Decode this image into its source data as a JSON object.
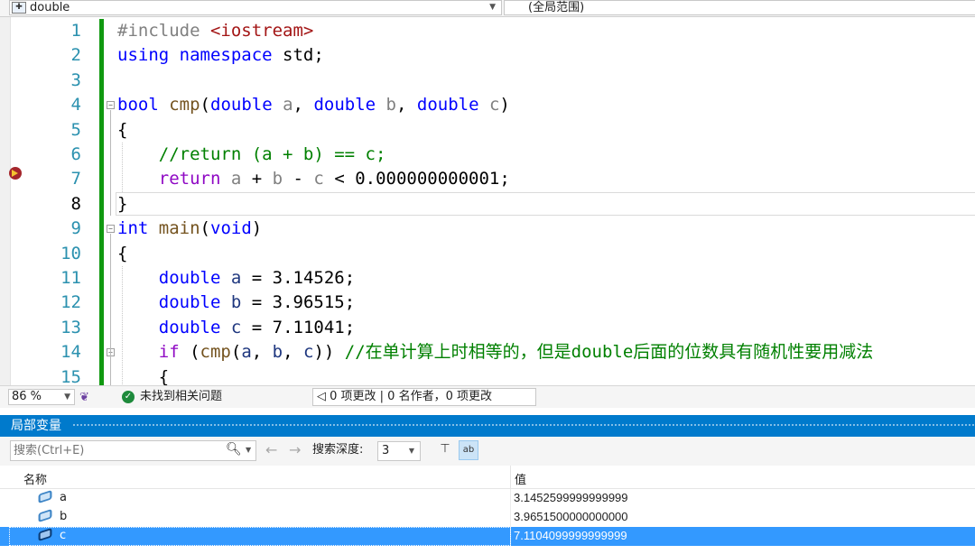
{
  "nav": {
    "class_combo": "double",
    "scope_combo": "(全局范围)"
  },
  "editor": {
    "lines": [
      {
        "n": "1",
        "tokens": [
          [
            "pp",
            "#include "
          ],
          [
            "str",
            "<iostream>"
          ]
        ]
      },
      {
        "n": "2",
        "tokens": [
          [
            "kw",
            "using"
          ],
          [
            "id",
            " "
          ],
          [
            "kw",
            "namespace"
          ],
          [
            "id",
            " std;"
          ]
        ]
      },
      {
        "n": "3",
        "tokens": []
      },
      {
        "n": "4",
        "tokens": [
          [
            "kw",
            "bool"
          ],
          [
            "id",
            " "
          ],
          [
            "fn",
            "cmp"
          ],
          [
            "id",
            "("
          ],
          [
            "kw",
            "double"
          ],
          [
            "id",
            " "
          ],
          [
            "par",
            "a"
          ],
          [
            "id",
            ", "
          ],
          [
            "kw",
            "double"
          ],
          [
            "id",
            " "
          ],
          [
            "par",
            "b"
          ],
          [
            "id",
            ", "
          ],
          [
            "kw",
            "double"
          ],
          [
            "id",
            " "
          ],
          [
            "par",
            "c"
          ],
          [
            "id",
            ")"
          ]
        ]
      },
      {
        "n": "5",
        "tokens": [
          [
            "id",
            "{"
          ]
        ]
      },
      {
        "n": "6",
        "tokens": [
          [
            "id",
            "    "
          ],
          [
            "cmt",
            "//return (a + b) == c;"
          ]
        ]
      },
      {
        "n": "7",
        "tokens": [
          [
            "id",
            "    "
          ],
          [
            "ctl",
            "return"
          ],
          [
            "id",
            " "
          ],
          [
            "par",
            "a"
          ],
          [
            "id",
            " + "
          ],
          [
            "par",
            "b"
          ],
          [
            "id",
            " - "
          ],
          [
            "par",
            "c"
          ],
          [
            "id",
            " < 0.000000000001;"
          ]
        ]
      },
      {
        "n": "8",
        "tokens": [
          [
            "id",
            "}"
          ]
        ]
      },
      {
        "n": "9",
        "tokens": [
          [
            "kw",
            "int"
          ],
          [
            "id",
            " "
          ],
          [
            "fn",
            "main"
          ],
          [
            "id",
            "("
          ],
          [
            "kw",
            "void"
          ],
          [
            "id",
            ")"
          ]
        ]
      },
      {
        "n": "10",
        "tokens": [
          [
            "id",
            "{"
          ]
        ]
      },
      {
        "n": "11",
        "tokens": [
          [
            "id",
            "    "
          ],
          [
            "kw",
            "double"
          ],
          [
            "id",
            " "
          ],
          [
            "loc",
            "a"
          ],
          [
            "id",
            " = 3.14526;"
          ]
        ]
      },
      {
        "n": "12",
        "tokens": [
          [
            "id",
            "    "
          ],
          [
            "kw",
            "double"
          ],
          [
            "id",
            " "
          ],
          [
            "loc",
            "b"
          ],
          [
            "id",
            " = 3.96515;"
          ]
        ]
      },
      {
        "n": "13",
        "tokens": [
          [
            "id",
            "    "
          ],
          [
            "kw",
            "double"
          ],
          [
            "id",
            " "
          ],
          [
            "loc",
            "c"
          ],
          [
            "id",
            " = 7.11041;"
          ]
        ]
      },
      {
        "n": "14",
        "tokens": [
          [
            "id",
            "    "
          ],
          [
            "ctl",
            "if"
          ],
          [
            "id",
            " ("
          ],
          [
            "fn",
            "cmp"
          ],
          [
            "id",
            "("
          ],
          [
            "loc",
            "a"
          ],
          [
            "id",
            ", "
          ],
          [
            "loc",
            "b"
          ],
          [
            "id",
            ", "
          ],
          [
            "loc",
            "c"
          ],
          [
            "id",
            ")) "
          ],
          [
            "cmt",
            "//在单计算上时相等的，但是double后面的位数具有随机性要用减法"
          ]
        ]
      },
      {
        "n": "15",
        "tokens": [
          [
            "id",
            "    {"
          ]
        ]
      }
    ]
  },
  "status": {
    "zoom": "86 %",
    "issues": "未找到相关问题",
    "changes": "◁ 0 项更改 | 0 名作者，0 项更改"
  },
  "locals": {
    "title": "局部变量",
    "search_placeholder": "搜索(Ctrl+E)",
    "depth_label": "搜索深度:",
    "depth_value": "3",
    "col_name": "名称",
    "col_value": "值",
    "rows": [
      {
        "name": "a",
        "value": "3.1452599999999999"
      },
      {
        "name": "b",
        "value": "3.9651500000000000"
      },
      {
        "name": "c",
        "value": "7.1104099999999999"
      }
    ],
    "selected_row": 2
  },
  "colors": {
    "accent": "#007acc",
    "selection": "#3399ff",
    "change_bar": "#109910",
    "breakpoint": "#a4262c"
  }
}
